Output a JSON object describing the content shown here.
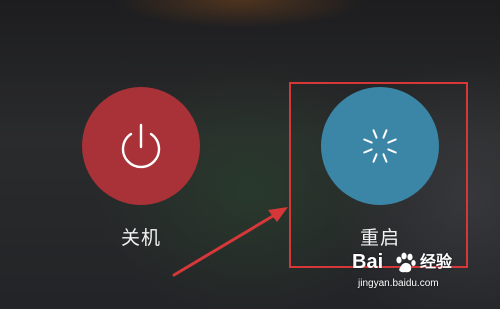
{
  "power_menu": {
    "shutdown": {
      "label": "关机",
      "icon": "power-icon",
      "color": "#a83237"
    },
    "restart": {
      "label": "重启",
      "icon": "loading-spinner-icon",
      "color": "#3b86a6"
    }
  },
  "annotation": {
    "highlight_color": "#d6383a",
    "target": "restart"
  },
  "watermark": {
    "brand_left": "Bai",
    "brand_right": "经验",
    "url": "jingyan.baidu.com"
  }
}
